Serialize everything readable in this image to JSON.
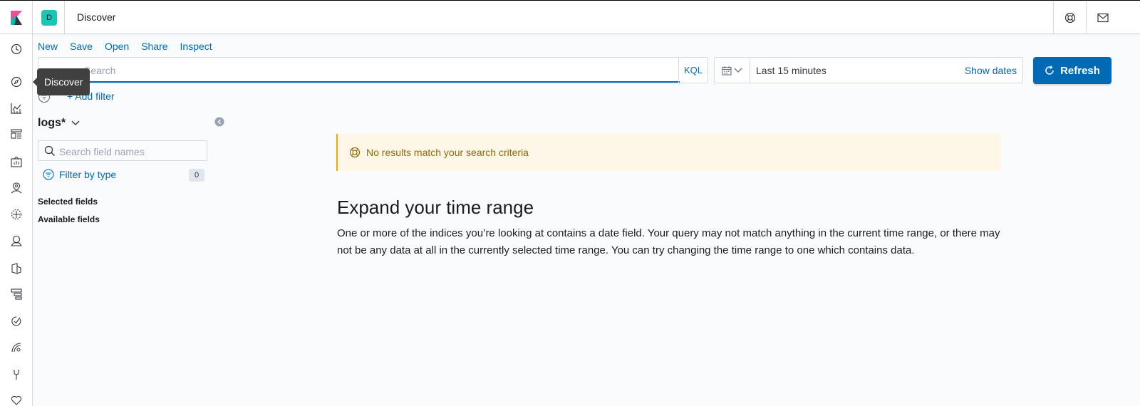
{
  "header": {
    "space_initial": "D",
    "breadcrumb": "Discover",
    "help_icon": "help-icon",
    "mail_icon": "mail-icon"
  },
  "nav": {
    "items": [
      "recent-icon",
      "discover-icon",
      "visualize-icon",
      "dashboard-icon",
      "canvas-icon",
      "maps-icon",
      "ml-icon",
      "siem-icon",
      "logs-icon",
      "infra-icon",
      "uptime-icon",
      "apm-icon",
      "devtools-icon",
      "monitoring-icon"
    ],
    "tooltip": "Discover"
  },
  "topmenu": {
    "new": "New",
    "save": "Save",
    "open": "Open",
    "share": "Share",
    "inspect": "Inspect"
  },
  "query": {
    "placeholder": "Search",
    "language": "KQL"
  },
  "time": {
    "range": "Last 15 minutes",
    "show_dates": "Show dates",
    "refresh": "Refresh"
  },
  "filters": {
    "add": "+ Add filter"
  },
  "sidebar": {
    "index_pattern": "logs*",
    "field_search_placeholder": "Search field names",
    "filter_by_type": "Filter by type",
    "filter_count": "0",
    "selected_fields": "Selected fields",
    "available_fields": "Available fields"
  },
  "main": {
    "callout": "No results match your search criteria",
    "title": "Expand your time range",
    "body": "One or more of the indices you’re looking at contains a date field. Your query may not match anything in the current time range, or there may not be any data at all in the currently selected time range. You can try changing the time range to one which contains data."
  },
  "colors": {
    "primary": "#006bb4",
    "warning": "#f5a700",
    "space": "#1ec3b5"
  }
}
